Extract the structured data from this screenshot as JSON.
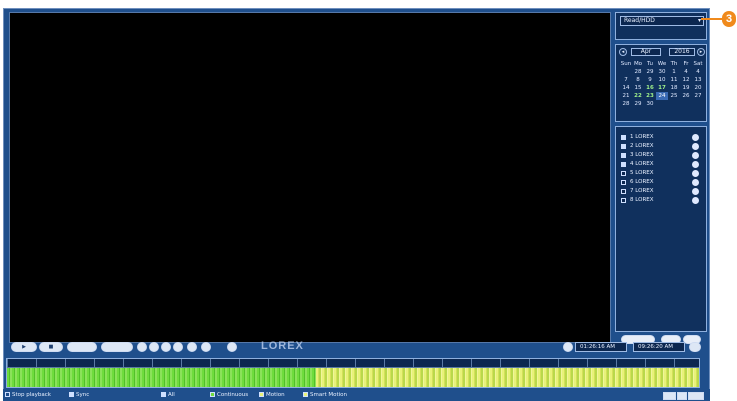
{
  "drive": {
    "selected": "Read/HDD"
  },
  "calendar": {
    "month": "Apr",
    "year": "2016",
    "prev": "◂",
    "next": "▸",
    "weekdays": [
      "Sun",
      "Mo",
      "Tu",
      "We",
      "Th",
      "Fr",
      "Sat"
    ],
    "weeks": [
      [
        "",
        "28",
        "29",
        "30",
        "1",
        "4",
        "4"
      ],
      [
        "7",
        "8",
        "9",
        "10",
        "11",
        "12",
        "13"
      ],
      [
        "14",
        "15",
        "16",
        "17",
        "18",
        "19",
        "20"
      ],
      [
        "21",
        "22",
        "23",
        "24",
        "25",
        "26",
        "27"
      ],
      [
        "28",
        "29",
        "30",
        "",
        "",
        "",
        ""
      ]
    ]
  },
  "channels": [
    {
      "label": "1 LOREX",
      "checked": true
    },
    {
      "label": "2 LOREX",
      "checked": true
    },
    {
      "label": "3 LOREX",
      "checked": true
    },
    {
      "label": "4 LOREX",
      "checked": true
    },
    {
      "label": "5 LOREX",
      "checked": false
    },
    {
      "label": "6 LOREX",
      "checked": false
    },
    {
      "label": "7 LOREX",
      "checked": false
    },
    {
      "label": "8 LOREX",
      "checked": false
    }
  ],
  "controls": {
    "play": "▶",
    "stop": "■",
    "logo": "LOREX",
    "start_time": "01:26:16 AM",
    "end_time": "09:26:20 AM"
  },
  "legend": {
    "stop_playback": "Stop playback",
    "sync": "Sync",
    "all": "All",
    "continuous": "Continuous",
    "motion": "Motion",
    "smart_motion": "Smart Motion"
  },
  "callout": {
    "number": "3"
  },
  "colors": {
    "accent": "#f08a1c",
    "continuous": "#6fdc3d",
    "smart_motion": "#e8f27a",
    "frame": "#1f4f8c"
  }
}
